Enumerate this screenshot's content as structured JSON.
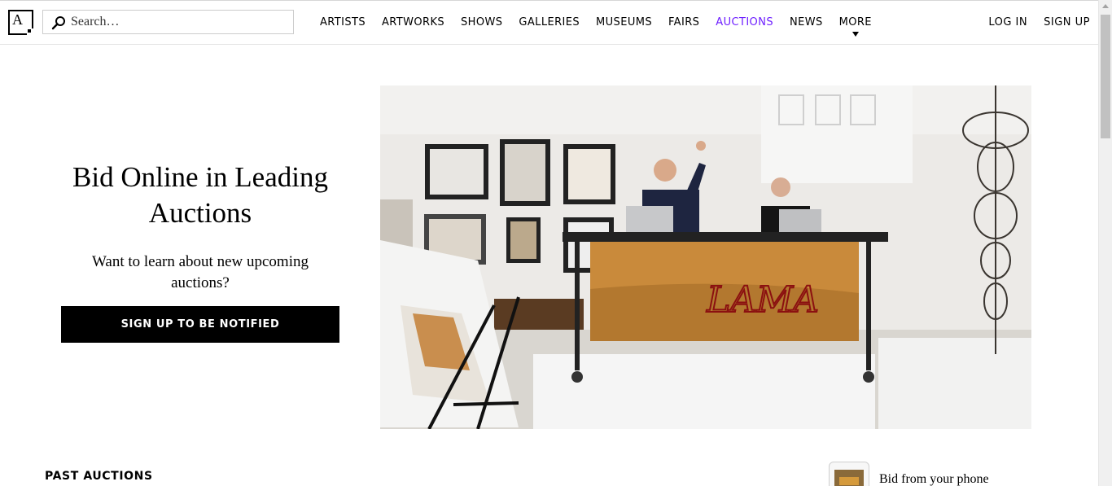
{
  "header": {
    "logo_text": "A",
    "search": {
      "placeholder": "Search…",
      "value": ""
    },
    "nav": [
      {
        "label": "ARTISTS"
      },
      {
        "label": "ARTWORKS"
      },
      {
        "label": "SHOWS"
      },
      {
        "label": "GALLERIES"
      },
      {
        "label": "MUSEUMS"
      },
      {
        "label": "FAIRS"
      },
      {
        "label": "AUCTIONS",
        "active": true
      },
      {
        "label": "NEWS"
      },
      {
        "label": "MORE"
      }
    ],
    "login_label": "LOG IN",
    "signup_label": "SIGN UP",
    "active_color": "#6e1fff"
  },
  "hero": {
    "title": "Bid Online in Leading Auctions",
    "subtitle": "Want to learn about new upcoming auctions?",
    "cta_label": "SIGN UP TO BE NOTIFIED",
    "image_sign_text": "LAMA"
  },
  "sections": {
    "past_auctions_label": "PAST AUCTIONS",
    "bid_phone_label": "Bid from your phone"
  }
}
